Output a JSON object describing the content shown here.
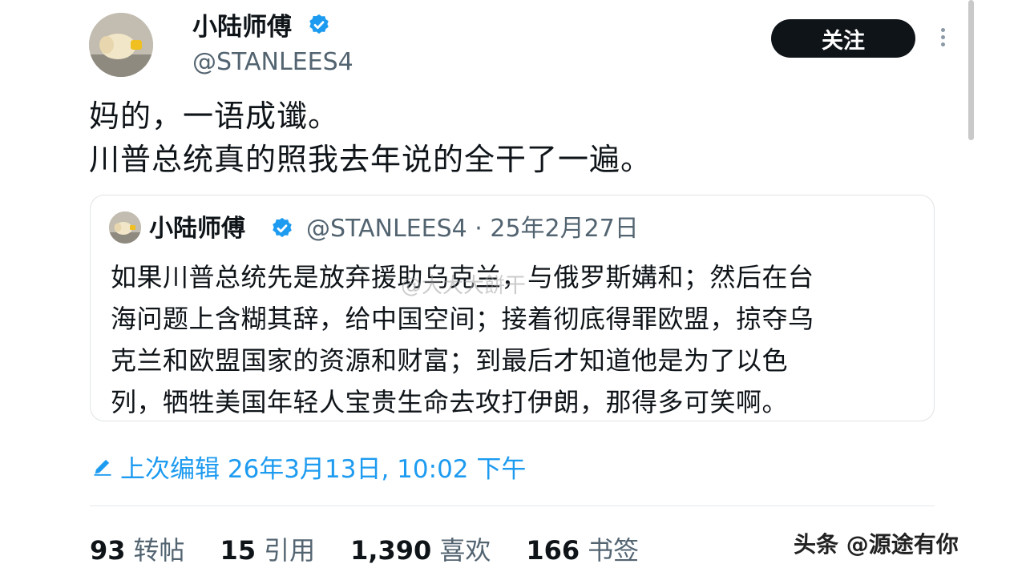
{
  "author": {
    "name": "小陆师傅",
    "handle": "@STANLEES4"
  },
  "follow_label": "关注",
  "tweet": {
    "lines": [
      "妈的，一语成谶。",
      "川普总统真的照我去年说的全干了一遍。"
    ]
  },
  "quote": {
    "name": "小陆师傅",
    "meta": "@STANLEES4 · 25年2月27日",
    "lines": [
      "如果川普总统先是放弃援助乌克兰，与俄罗斯媾和；然后在台",
      "海问题上含糊其辞，给中国空间；接着彻底得罪欧盟，掠夺乌",
      "克兰和欧盟国家的资源和财富；到最后才知道他是为了以色",
      "列，牺牲美国年轻人宝贵生命去攻打伊朗，那得多可笑啊。"
    ],
    "watermark": "@大大大餅干"
  },
  "edited": "上次编辑 26年3月13日, 10:02 下午",
  "stats": [
    {
      "num": "93",
      "label": "转帖"
    },
    {
      "num": "15",
      "label": "引用"
    },
    {
      "num": "1,390",
      "label": "喜欢"
    },
    {
      "num": "166",
      "label": "书签"
    }
  ],
  "footer_watermark": "头条 @源途有你",
  "colors": {
    "accent": "#1d9bf0",
    "text": "#0f1419",
    "muted": "#536471"
  }
}
